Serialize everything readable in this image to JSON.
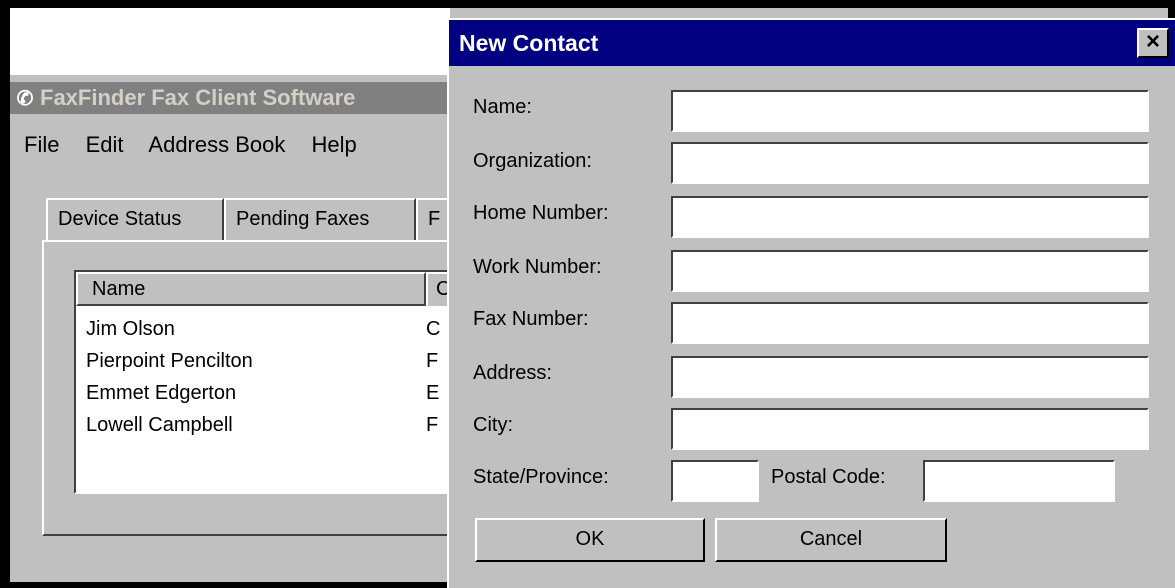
{
  "app": {
    "title": "FaxFinder Fax Client Software",
    "menu": [
      "File",
      "Edit",
      "Address Book",
      "Help"
    ],
    "tabs": [
      "Device Status",
      "Pending Faxes",
      "F"
    ],
    "list": {
      "columns": [
        "Name",
        "C"
      ],
      "rows": [
        {
          "name": "Jim Olson",
          "c2": "C"
        },
        {
          "name": "Pierpoint Pencilton",
          "c2": "F"
        },
        {
          "name": "Emmet Edgerton",
          "c2": "E"
        },
        {
          "name": "Lowell Campbell",
          "c2": "F"
        }
      ]
    }
  },
  "dialog": {
    "title": "New Contact",
    "close": "×",
    "fields": {
      "name": {
        "label": "Name:",
        "value": ""
      },
      "organization": {
        "label": "Organization:",
        "value": ""
      },
      "home": {
        "label": "Home Number:",
        "value": ""
      },
      "work": {
        "label": "Work Number:",
        "value": ""
      },
      "fax": {
        "label": "Fax Number:",
        "value": ""
      },
      "address": {
        "label": "Address:",
        "value": ""
      },
      "city": {
        "label": "City:",
        "value": ""
      },
      "state": {
        "label": "State/Province:",
        "value": ""
      },
      "postal": {
        "label": "Postal Code:",
        "value": ""
      }
    },
    "buttons": {
      "ok": "OK",
      "cancel": "Cancel"
    }
  }
}
